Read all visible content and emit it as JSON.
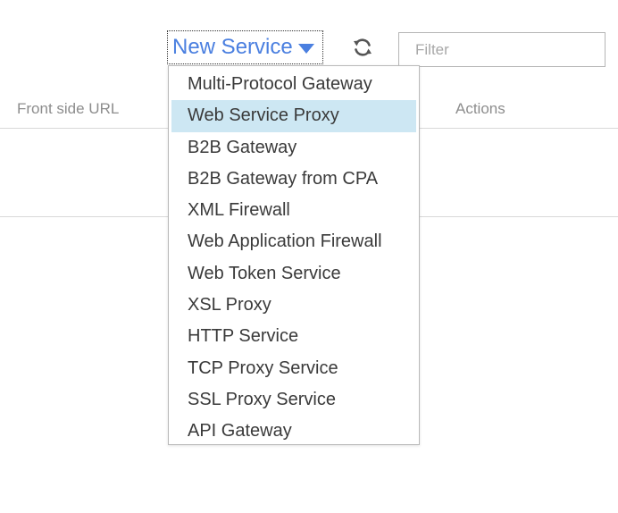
{
  "toolbar": {
    "new_service_label": "New Service",
    "filter_placeholder": "Filter",
    "refresh_icon": "refresh-icon"
  },
  "table": {
    "columns": [
      "Front side URL",
      "Actions"
    ]
  },
  "dropdown": {
    "selected_index": 1,
    "items": [
      "Multi-Protocol Gateway",
      "Web Service Proxy",
      "B2B Gateway",
      "B2B Gateway from CPA",
      "XML Firewall",
      "Web Application Firewall",
      "Web Token Service",
      "XSL Proxy",
      "HTTP Service",
      "TCP Proxy Service",
      "SSL Proxy Service",
      "API Gateway"
    ]
  },
  "colors": {
    "accent": "#4a7fe0",
    "selected_bg": "#cde7f3",
    "header_text": "#8d8d8d"
  }
}
